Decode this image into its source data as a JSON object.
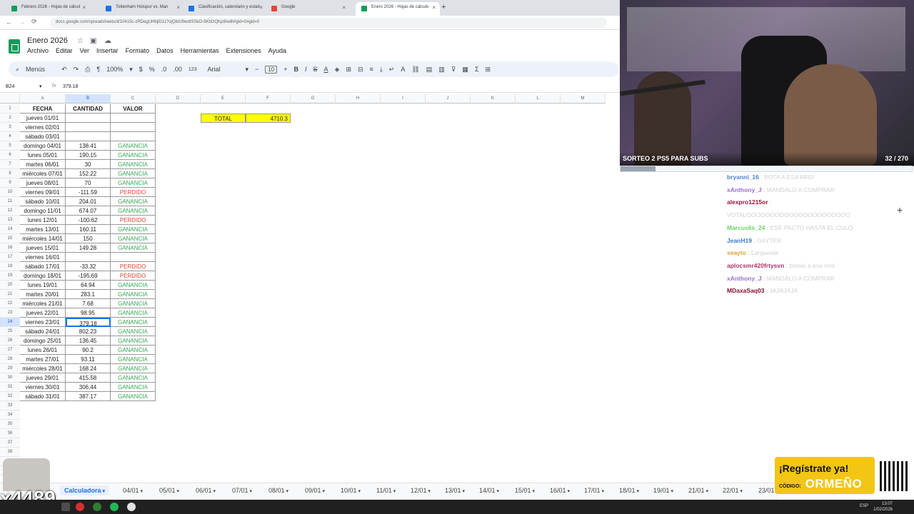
{
  "browser": {
    "tabs": [
      {
        "title": "Febrero 2026 - Hojas de cálcul",
        "color": "#0f9d58"
      },
      {
        "title": "Tottenham Hotspur vs. Man",
        "color": "#1a73e8"
      },
      {
        "title": "Clasificación, calendario y estad",
        "color": "#1a73e8"
      },
      {
        "title": "Google",
        "color": "#ea4335"
      },
      {
        "title": "Enero 2026 - Hojas de cálculo",
        "color": "#0f9d58"
      }
    ],
    "url": "docs.google.com/spreadsheets/d/10415c-zRDegUHbjlD11?ojQktU9wdtSSkO-9KbOQKp8/edit#gid=0#gid=0"
  },
  "sheets": {
    "doc_title": "Enero 2026",
    "menu": [
      "Archivo",
      "Editar",
      "Ver",
      "Insertar",
      "Formato",
      "Datos",
      "Herramientas",
      "Extensiones",
      "Ayuda"
    ],
    "toolbar": {
      "menus": "Menús",
      "zoom": "100%",
      "currency": "$",
      "percent": "%",
      "dec_dec": ".0",
      "inc_dec": ".00",
      "numfmt": "123",
      "font": "Arial",
      "font_size": "10"
    },
    "cell_ref": "B24",
    "formula": "379.18",
    "columns": [
      "A",
      "B",
      "C",
      "D",
      "E",
      "F",
      "G",
      "H",
      "I",
      "J",
      "K",
      "L",
      "M"
    ],
    "header_row": {
      "fecha": "FECHA",
      "cantidad": "CANTIDAD",
      "valor": "VALOR"
    },
    "total_label": "TOTAL",
    "total_value": "4710.3",
    "rows": [
      {
        "fecha": "jueves 01/01",
        "cantidad": "",
        "valor": ""
      },
      {
        "fecha": "viernes 02/01",
        "cantidad": "",
        "valor": ""
      },
      {
        "fecha": "sábado 03/01",
        "cantidad": "",
        "valor": ""
      },
      {
        "fecha": "domingo 04/01",
        "cantidad": "138.41",
        "valor": "GANANCIA"
      },
      {
        "fecha": "lunes 05/01",
        "cantidad": "190.15",
        "valor": "GANANCIA"
      },
      {
        "fecha": "martes 06/01",
        "cantidad": "30",
        "valor": "GANANCIA"
      },
      {
        "fecha": "miércoles 07/01",
        "cantidad": "152.22",
        "valor": "GANANCIA"
      },
      {
        "fecha": "jueves 08/01",
        "cantidad": "70",
        "valor": "GANANCIA"
      },
      {
        "fecha": "viernes 09/01",
        "cantidad": "-111.59",
        "valor": "PERDIDO"
      },
      {
        "fecha": "sábado 10/01",
        "cantidad": "204.01",
        "valor": "GANANCIA"
      },
      {
        "fecha": "domingo 11/01",
        "cantidad": "674.07",
        "valor": "GANANCIA"
      },
      {
        "fecha": "lunes 12/01",
        "cantidad": "-100.62",
        "valor": "PERDIDO"
      },
      {
        "fecha": "martes 13/01",
        "cantidad": "160.11",
        "valor": "GANANCIA"
      },
      {
        "fecha": "miércoles 14/01",
        "cantidad": "150",
        "valor": "GANANCIA"
      },
      {
        "fecha": "jueves 15/01",
        "cantidad": "149.28",
        "valor": "GANANCIA"
      },
      {
        "fecha": "viernes 16/01",
        "cantidad": "",
        "valor": ""
      },
      {
        "fecha": "sábado 17/01",
        "cantidad": "-33.32",
        "valor": "PERDIDO"
      },
      {
        "fecha": "domingo 18/01",
        "cantidad": "-195.69",
        "valor": "PERDIDO"
      },
      {
        "fecha": "lunes 19/01",
        "cantidad": "64.94",
        "valor": "GANANCIA"
      },
      {
        "fecha": "martes 20/01",
        "cantidad": "283.1",
        "valor": "GANANCIA"
      },
      {
        "fecha": "miércoles 21/01",
        "cantidad": "7.68",
        "valor": "GANANCIA"
      },
      {
        "fecha": "jueves 22/01",
        "cantidad": "98.95",
        "valor": "GANANCIA"
      },
      {
        "fecha": "viernes 23/01",
        "cantidad": "379.18",
        "valor": "GANANCIA"
      },
      {
        "fecha": "sábado 24/01",
        "cantidad": "802.23",
        "valor": "GANANCIA"
      },
      {
        "fecha": "domingo 25/01",
        "cantidad": "136.45",
        "valor": "GANANCIA"
      },
      {
        "fecha": "lunes 26/01",
        "cantidad": "90.2",
        "valor": "GANANCIA"
      },
      {
        "fecha": "martes 27/01",
        "cantidad": "93.11",
        "valor": "GANANCIA"
      },
      {
        "fecha": "miércoles 28/01",
        "cantidad": "168.24",
        "valor": "GANANCIA"
      },
      {
        "fecha": "jueves 29/01",
        "cantidad": "415.58",
        "valor": "GANANCIA"
      },
      {
        "fecha": "viernes 30/01",
        "cantidad": "306.44",
        "valor": "GANANCIA"
      },
      {
        "fecha": "sábado 31/01",
        "cantidad": "387.17",
        "valor": "GANANCIA"
      }
    ],
    "sheet_tabs": [
      "Calculadora",
      "04/01",
      "05/01",
      "06/01",
      "07/01",
      "08/01",
      "09/01",
      "10/01",
      "11/01",
      "12/01",
      "13/01",
      "14/01",
      "15/01",
      "16/01",
      "17/01",
      "18/01",
      "19/01",
      "21/01",
      "22/01",
      "23/01"
    ]
  },
  "stream": {
    "title": "SORTEO 2 PS5 PARA SUBS",
    "count": "32 / 270",
    "progress": 0.12,
    "chat": [
      {
        "user": "bryanni_16",
        "text": "BOTA A ESA MRD",
        "color": "#4a7fd1"
      },
      {
        "user": "xAnthony_J",
        "text": "MANDALO A COMPRAR",
        "color": "#9b6fd0"
      },
      {
        "user": "alexpro1215or",
        "text": "",
        "color": "#a0133a"
      },
      {
        "user": "",
        "text": "VOTALOOOOOOOOOOOOOOOOOOOOOO",
        "color": "#a0133a"
      },
      {
        "user": "Marcus6s_24",
        "text": "ESE PACTO HASTA EL CULO",
        "color": "#6bd36b"
      },
      {
        "user": "JeanH19",
        "text": "GAYTER",
        "color": "#3f78c9"
      },
      {
        "user": "seayto",
        "text": "Largueate",
        "color": "#d9a23a"
      },
      {
        "user": "aplocsmr420frtysvn",
        "text": "botalo a esa mrd",
        "color": "#b03366"
      },
      {
        "user": "xAnthony_J",
        "text": "MANDALO A COMPRAR",
        "color": "#9b6fd0"
      },
      {
        "user": "MDaxaSaq03",
        "text": "JAJAJAJA",
        "color": "#8a0f2c"
      }
    ],
    "promo": {
      "title": "¡Regístrate ya!",
      "code_label": "CÓDIGO:",
      "code": "ORMEÑO"
    },
    "overlay_count": "x4489"
  },
  "taskbar": {
    "lang": "ESP",
    "time": "13:07",
    "date": "1/02/2026"
  }
}
